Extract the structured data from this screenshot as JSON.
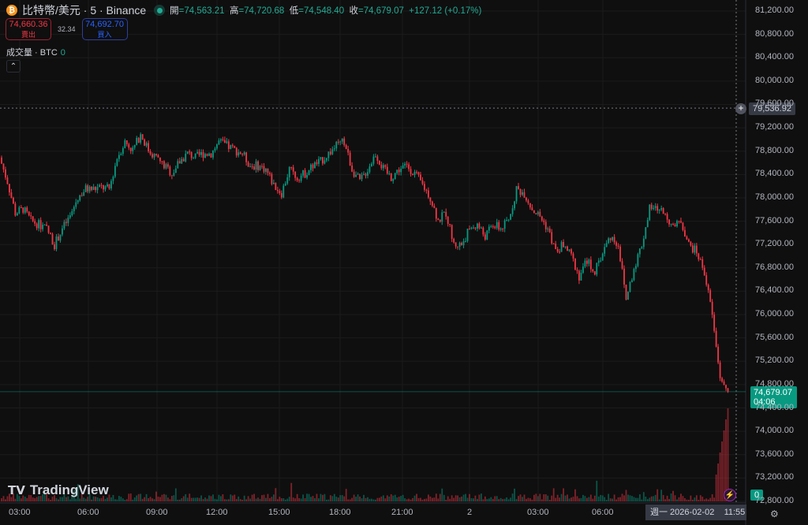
{
  "header": {
    "symbol": "比特幣/美元 · 5 · Binance",
    "open_label": "開",
    "open": "74,563.21",
    "high_label": "高",
    "high": "74,720.68",
    "low_label": "低",
    "low": "74,548.40",
    "close_label": "收",
    "close": "74,679.07",
    "change": "+127.12 (+0.17%)"
  },
  "trade": {
    "sell_price": "74,660.36",
    "sell_label": "賣出",
    "spread": "32.34",
    "buy_price": "74,692.70",
    "buy_label": "買入"
  },
  "volume": {
    "label": "成交量 · BTC",
    "value": "0"
  },
  "logo": "TradingView",
  "crosshair": {
    "price": "79,536.92",
    "date": "週一 2026-02-02",
    "time": "11:55"
  },
  "last_price": {
    "price": "74,679.07",
    "countdown": "04:06"
  },
  "colors": {
    "up": "#089981",
    "down": "#f23645",
    "background": "#0f0f0f"
  },
  "chart_data": {
    "type": "candlestick",
    "ylim": [
      72800,
      81200
    ],
    "y_ticks": [
      "81,200.00",
      "80,800.00",
      "80,400.00",
      "80,000.00",
      "79,600.00",
      "79,200.00",
      "78,800.00",
      "78,400.00",
      "78,000.00",
      "77,600.00",
      "77,200.00",
      "76,800.00",
      "76,400.00",
      "76,000.00",
      "75,600.00",
      "75,200.00",
      "74,800.00",
      "74,400.00",
      "74,000.00",
      "73,600.00",
      "73,200.00",
      "72,800.00"
    ],
    "x_ticks": [
      "03:00",
      "06:00",
      "09:00",
      "12:00",
      "15:00",
      "18:00",
      "21:00",
      "2",
      "03:00",
      "06:00"
    ],
    "grid": true,
    "approx_close_path": [
      78690,
      78280,
      77740,
      77810,
      77610,
      77540,
      77470,
      77200,
      77470,
      77680,
      78010,
      78150,
      78150,
      78180,
      78150,
      78690,
      78960,
      78820,
      79090,
      78820,
      78690,
      78550,
      78420,
      78620,
      78760,
      78690,
      78760,
      78760,
      78960,
      78890,
      78820,
      78760,
      78550,
      78550,
      78490,
      78220,
      78080,
      78490,
      78350,
      78420,
      78550,
      78620,
      78760,
      78890,
      78960,
      78490,
      78280,
      78490,
      78760,
      78490,
      78350,
      78490,
      78550,
      78420,
      78220,
      78010,
      77610,
      77740,
      77200,
      77200,
      77470,
      77540,
      77340,
      77540,
      77470,
      77610,
      78150,
      78080,
      77810,
      77680,
      77470,
      77070,
      77200,
      77000,
      76660,
      76930,
      76730,
      77070,
      77340,
      77200,
      76260,
      76800,
      77200,
      77810,
      77810,
      77740,
      77470,
      77610,
      77200,
      77070,
      76730,
      75990,
      74910,
      74679.07
    ]
  }
}
